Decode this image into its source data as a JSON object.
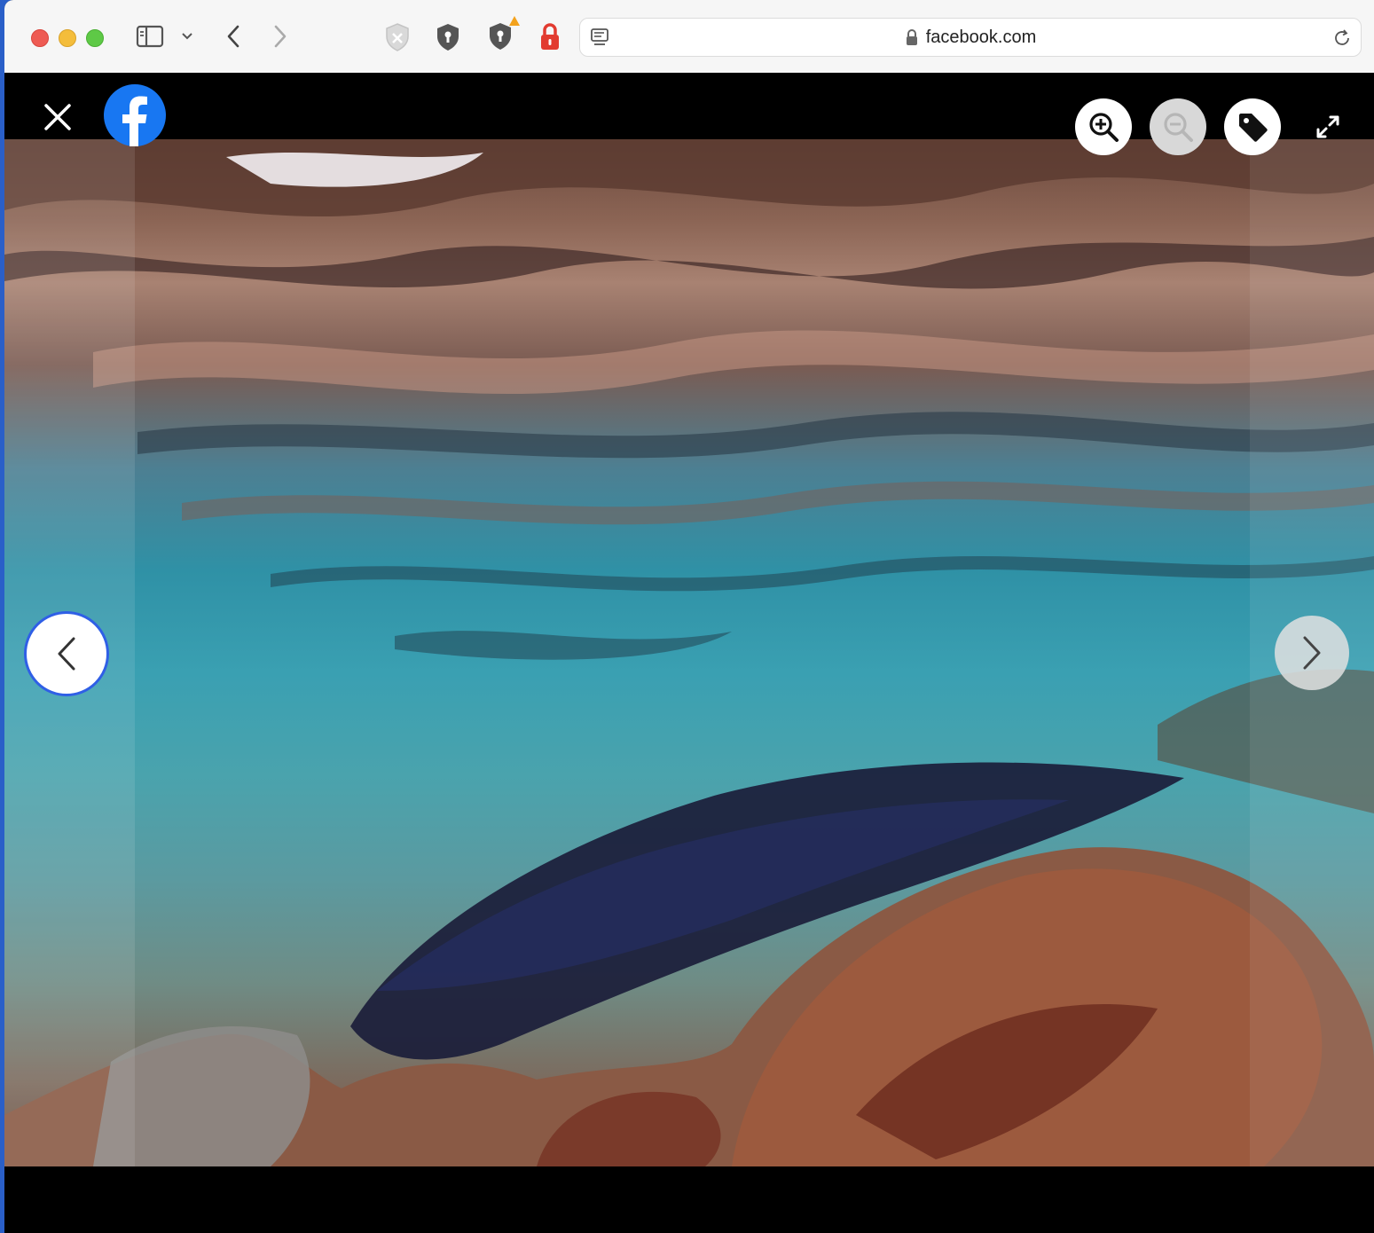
{
  "browser": {
    "url_display": "facebook.com",
    "controls": {
      "close_window": "close",
      "minimize_window": "minimize",
      "maximize_window": "maximize"
    },
    "toolbar_icons": [
      "sidebar-icon",
      "chevron-down-icon",
      "back-icon",
      "forward-icon",
      "shield-disabled-icon",
      "shield-icon",
      "shield-warning-icon",
      "lock-red-icon",
      "reader-icon",
      "lock-icon",
      "reload-icon"
    ]
  },
  "viewer": {
    "icons": [
      "close-icon",
      "facebook-logo",
      "zoom-in-icon",
      "zoom-out-icon",
      "tag-icon",
      "fullscreen-icon",
      "chevron-left-icon",
      "chevron-right-icon"
    ],
    "colors": {
      "facebook_blue": "#1877f2",
      "focus_ring": "#2f5fe6",
      "background": "#000000"
    }
  }
}
